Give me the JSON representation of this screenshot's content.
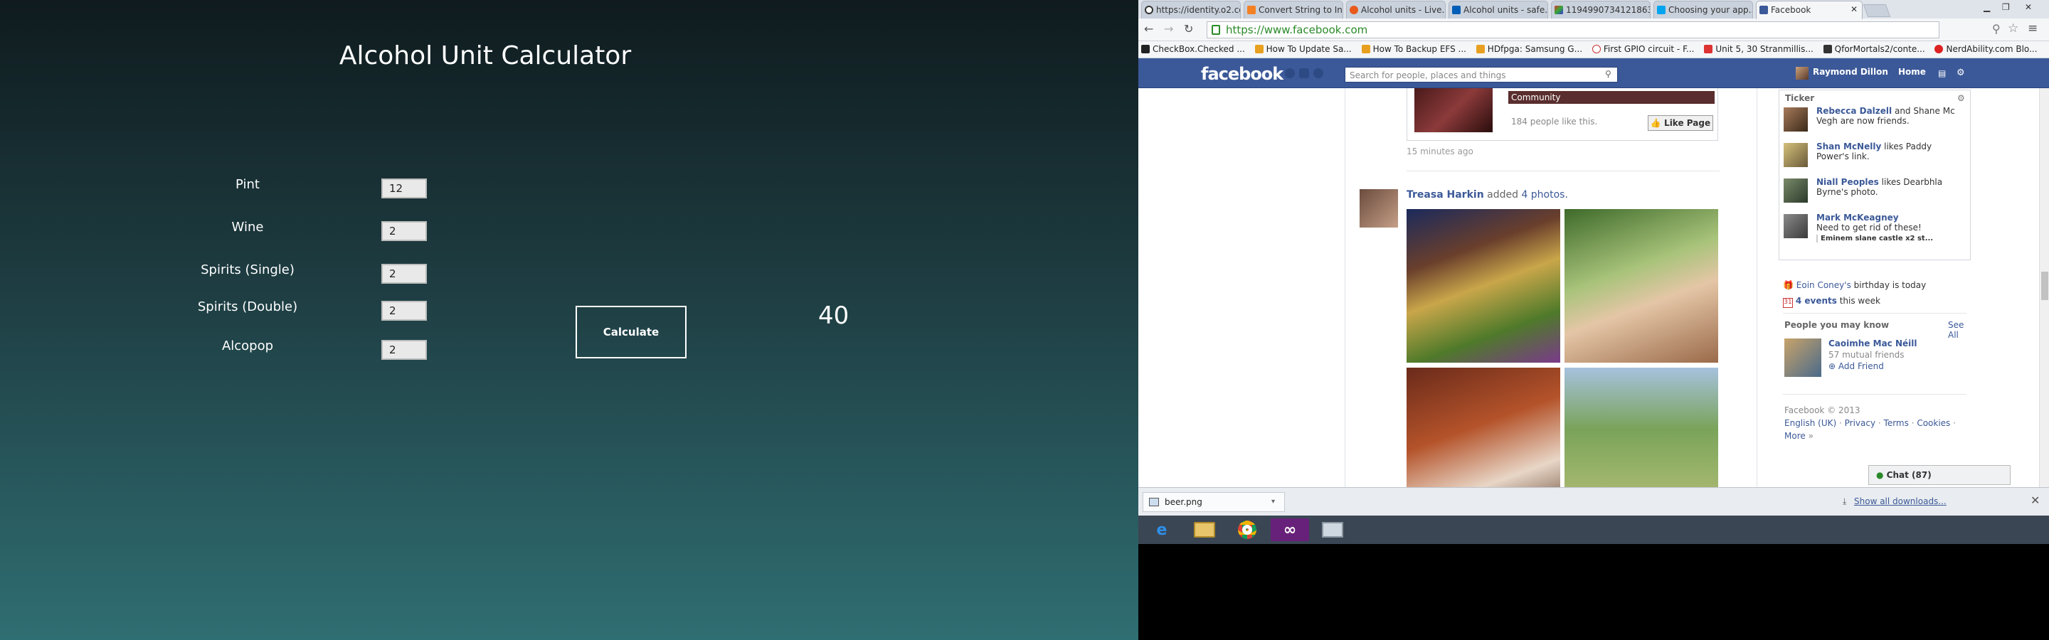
{
  "calculator": {
    "title": "Alcohol Unit Calculator",
    "rows": [
      {
        "label": "Pint",
        "value": "12"
      },
      {
        "label": "Wine",
        "value": "2"
      },
      {
        "label": "Spirits (Single)",
        "value": "2"
      },
      {
        "label": "Spirits (Double)",
        "value": "2"
      },
      {
        "label": "Alcopop",
        "value": "2"
      }
    ],
    "button_label": "Calculate",
    "result": "40"
  },
  "browser": {
    "tabs": [
      {
        "label": "https://identity.o2.co.uk/...",
        "icon": "o2-icon"
      },
      {
        "label": "Convert String to In...",
        "icon": "so-icon"
      },
      {
        "label": "Alcohol units - Live...",
        "icon": "alc-icon"
      },
      {
        "label": "Alcohol units - safe...",
        "icon": "nhs-icon"
      },
      {
        "label": "11949907341218633...",
        "icon": "img-icon"
      },
      {
        "label": "Choosing your app...",
        "icon": "ms-icon"
      },
      {
        "label": "Facebook",
        "icon": "facebook-icon"
      }
    ],
    "url": "https://www.facebook.com",
    "bookmarks": [
      "CheckBox.Checked ...",
      "How To Update Sa...",
      "How To Backup EFS ...",
      "HDfpga: Samsung G...",
      "First GPIO circuit - F...",
      "Unit 5, 30 Stranmillis...",
      "QforMortals2/conte...",
      "NerdAbility.com Blo..."
    ]
  },
  "facebook": {
    "logo": "facebook",
    "search_placeholder": "Search for people, places and things",
    "user_name": "Raymond Dillon",
    "home_label": "Home",
    "page_box": {
      "category": "Community",
      "likes": "184 people like this.",
      "like_button": "Like Page"
    },
    "time_ago": "15 minutes ago",
    "post": {
      "author": "Treasa Harkin",
      "action": "added",
      "link": "4 photos."
    },
    "ticker": {
      "title": "Ticker",
      "items": [
        {
          "name": "Rebecca Dalzell",
          "text": "and Shane Mc Vegh are now friends."
        },
        {
          "name": "Shan McNelly",
          "text": "likes Paddy Power's link."
        },
        {
          "name": "Niall Peoples",
          "text": "likes Dearbhla Byrne's photo."
        },
        {
          "name": "Mark McKeagney",
          "text": "Need to get rid of these!",
          "sub": "Eminem slane castle x2 st..."
        }
      ]
    },
    "birthday": {
      "name": "Eoin Coney's",
      "text": "birthday is today"
    },
    "events": {
      "count": "4 events",
      "text": "this week"
    },
    "pymk": {
      "title": "People you may know",
      "see_all": "See All",
      "name": "Caoimhe Mac Néill",
      "mutual": "57 mutual friends",
      "add": "Add Friend"
    },
    "footer": {
      "copyright": "Facebook © 2013",
      "links": [
        "English (UK)",
        "Privacy",
        "Terms",
        "Cookies",
        "More"
      ]
    },
    "chat": "Chat (87)"
  },
  "downloads": {
    "file": "beer.png",
    "show_all": "Show all downloads..."
  },
  "taskbar": {
    "apps": [
      "ie-icon",
      "explorer-icon",
      "chrome-icon",
      "visual-studio-icon",
      "remote-desktop-icon"
    ]
  }
}
